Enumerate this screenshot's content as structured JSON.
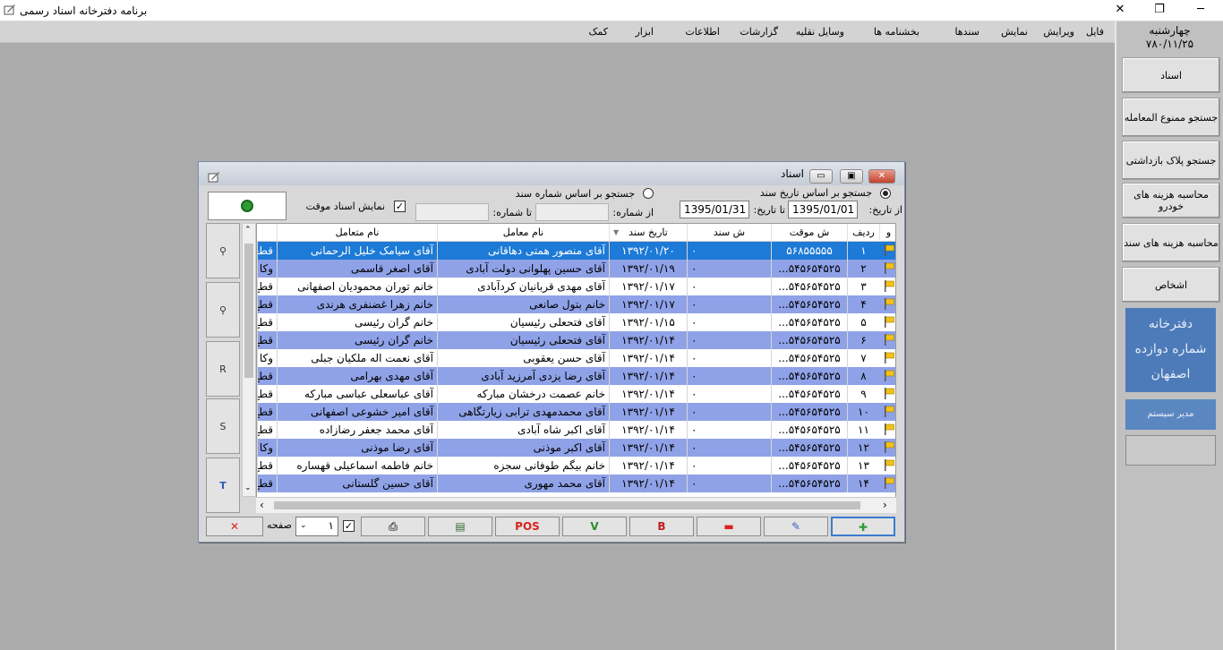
{
  "app": {
    "title": "برنامه دفترخانه اسناد رسمی"
  },
  "window_controls": {
    "minimize": "─",
    "maximize": "❐",
    "close": "✕"
  },
  "menu": [
    "فایل",
    "ویرایش",
    "نمایش",
    "سندها",
    "بخشنامه ها",
    "وسایل نقلیه",
    "گزارشات",
    "اطلاعات",
    "ابزار",
    "کمک"
  ],
  "side": {
    "day": "چهارشنبه",
    "date": "۷۸۰/۱۱/۲۵",
    "buttons": [
      "اسناد",
      "جستجو ممنوع المعامله",
      "جستجو پلاک بازداشتی",
      "محاسبه هزینه های خودرو",
      "محاسبه هزینه های سند",
      "اشخاص"
    ],
    "office": [
      "دفترخانه",
      "شماره دوازده",
      "اصفهان"
    ],
    "manager": "مدیر سیستم"
  },
  "dialog": {
    "title": "اسناد",
    "radio_date": "جستجو بر اساس تاریخ سند",
    "radio_number": "جستجو بر اساس شماره سند",
    "from_date_label": "از تاریخ:",
    "from_date": "1395/01/01",
    "to_date_label": "تا تاریخ:",
    "to_date": "1395/01/31",
    "from_num_label": "از شماره:",
    "to_num_label": "تا شماره:",
    "show_temp_label": "نمایش اسناد موقت",
    "page_label": "صفحه",
    "page_value": "۱",
    "pos_label": "POS",
    "v_label": "V",
    "b_label": "B",
    "side_letters": [
      "R",
      "S",
      "T"
    ],
    "columns": [
      "و",
      "ردیف",
      "ش موقت",
      "ش سند",
      "تاریخ سند",
      "نام معامل",
      "نام متعامل"
    ],
    "rows": [
      {
        "n": "۱",
        "temp": "۵۶۸۵۵۵۵۵",
        "doc": "۰",
        "date": "۱۳۹۲/۰۱/۲۰",
        "a": "آقای منصور همتی دهاقانی",
        "b": "آقای سیامک خلیل الرحمانی",
        "c": "قطعی"
      },
      {
        "n": "۲",
        "temp": "۵۴۵۶۵۴۵۲۵...",
        "doc": "۰",
        "date": "۱۳۹۲/۰۱/۱۹",
        "a": "آقای حسین پهلوانی دولت آبادی",
        "b": "آقای اصغر قاسمی",
        "c": "وکا"
      },
      {
        "n": "۳",
        "temp": "۵۴۵۶۵۴۵۲۵...",
        "doc": "۰",
        "date": "۱۳۹۲/۰۱/۱۷",
        "a": "آقای مهدی قربانیان کردآبادی",
        "b": "خانم توران محمودیان اصفهانی",
        "c": "قطع"
      },
      {
        "n": "۴",
        "temp": "۵۴۵۶۵۴۵۲۵...",
        "doc": "۰",
        "date": "۱۳۹۲/۰۱/۱۷",
        "a": "خانم بتول صانعی",
        "b": "خانم زهرا غضنفری هرندی",
        "c": "قطع"
      },
      {
        "n": "۵",
        "temp": "۵۴۵۶۵۴۵۲۵...",
        "doc": "۰",
        "date": "۱۳۹۲/۰۱/۱۵",
        "a": "آقای فتحعلی رئیسیان",
        "b": "خانم گران رئیسی",
        "c": "قطع"
      },
      {
        "n": "۶",
        "temp": "۵۴۵۶۵۴۵۲۵...",
        "doc": "۰",
        "date": "۱۳۹۲/۰۱/۱۴",
        "a": "آقای فتحعلی رئیسیان",
        "b": "خانم گران رئیسی",
        "c": "قطع"
      },
      {
        "n": "۷",
        "temp": "۵۴۵۶۵۴۵۲۵...",
        "doc": "۰",
        "date": "۱۳۹۲/۰۱/۱۴",
        "a": "آقای حسن یعقوبی",
        "b": "آقای نعمت اله ملکیان جبلی",
        "c": "وکا"
      },
      {
        "n": "۸",
        "temp": "۵۴۵۶۵۴۵۲۵...",
        "doc": "۰",
        "date": "۱۳۹۲/۰۱/۱۴",
        "a": "آقای رضا یزدی آمرزید آبادی",
        "b": "آقای مهدی بهرامی",
        "c": "قطع"
      },
      {
        "n": "۹",
        "temp": "۵۴۵۶۵۴۵۲۵...",
        "doc": "۰",
        "date": "۱۳۹۲/۰۱/۱۴",
        "a": "خانم عصمت درخشان مبارکه",
        "b": "آقای عباسعلی عباسی مبارکه",
        "c": "قطع"
      },
      {
        "n": "۱۰",
        "temp": "۵۴۵۶۵۴۵۲۵...",
        "doc": "۰",
        "date": "۱۳۹۲/۰۱/۱۴",
        "a": "آقای محمدمهدی ترابی زیارتگاهی",
        "b": "آقای امیر خشوعی اصفهانی",
        "c": "قطع"
      },
      {
        "n": "۱۱",
        "temp": "۵۴۵۶۵۴۵۲۵...",
        "doc": "۰",
        "date": "۱۳۹۲/۰۱/۱۴",
        "a": "آقای اکبر شاه آبادی",
        "b": "آقای محمد جعفر رضازاده",
        "c": "قطع"
      },
      {
        "n": "۱۲",
        "temp": "۵۴۵۶۵۴۵۲۵...",
        "doc": "۰",
        "date": "۱۳۹۲/۰۱/۱۴",
        "a": "آقای اکبر موذنی",
        "b": "آقای رضا موذنی",
        "c": "وکا"
      },
      {
        "n": "۱۳",
        "temp": "۵۴۵۶۵۴۵۲۵...",
        "doc": "۰",
        "date": "۱۳۹۲/۰۱/۱۴",
        "a": "خانم بیگم طوفانی سجزه",
        "b": "خانم فاطمه اسماعیلی قهساره",
        "c": "قطع"
      },
      {
        "n": "۱۴",
        "temp": "۵۴۵۶۵۴۵۲۵...",
        "doc": "۰",
        "date": "۱۳۹۲/۰۱/۱۴",
        "a": "آقای محمد مهوری",
        "b": "آقای حسین گلستانی",
        "c": "قطع"
      }
    ]
  },
  "colors": {
    "row_alt": "#8fa2e8",
    "row_selected": "#1d7ad6",
    "office_box": "#4d7bb9",
    "background": "#ababab"
  },
  "icons": [
    "app-icon",
    "refresh-icon",
    "search-icon",
    "flag-icon",
    "add-icon",
    "edit-icon",
    "remove-icon",
    "print-icon",
    "image-icon",
    "delete-icon",
    "sort-down-icon"
  ]
}
